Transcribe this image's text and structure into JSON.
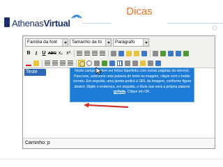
{
  "slide": {
    "title": "Dicas"
  },
  "logo": {
    "brand_part1": "Athenas",
    "brand_part2": "Virtual"
  },
  "editor": {
    "font_family_value": "Família da font",
    "font_size_value": "Tamanho da fo",
    "format_value": "Parágrafo",
    "content_selected_text": "Teste",
    "status_path": "Caminho: p",
    "toolbar_row2": [
      {
        "name": "bold-button",
        "label": "B"
      },
      {
        "name": "italic-button",
        "label": "I"
      },
      {
        "name": "underline-button",
        "label": "U"
      },
      {
        "name": "strikethrough-button",
        "label": "ABC"
      },
      {
        "name": "subscript-button",
        "label": "x₂"
      },
      {
        "name": "superscript-button",
        "label": "x²"
      }
    ]
  },
  "tooltip": {
    "text_before": "Neste campo podem ser feitos hiperlinks com outras páginas da internet. Para isso, selecione uma palavra do texto ou imagem, clique com o botão correto. Em seguida, uma janela pedirá a URL da imagem, conforme figura abaixo. Digite o endereço, em seguida, o título que será a própria palavra",
    "emphasis": "grifada",
    "text_after": ". Clique em OK."
  },
  "colors": {
    "title_orange": "#f37021",
    "logo_navy": "#1a2d6b",
    "callout_blue": "#1c7bd4",
    "selection_blue": "#2b68b8",
    "arrow_red": "#d0312d"
  }
}
